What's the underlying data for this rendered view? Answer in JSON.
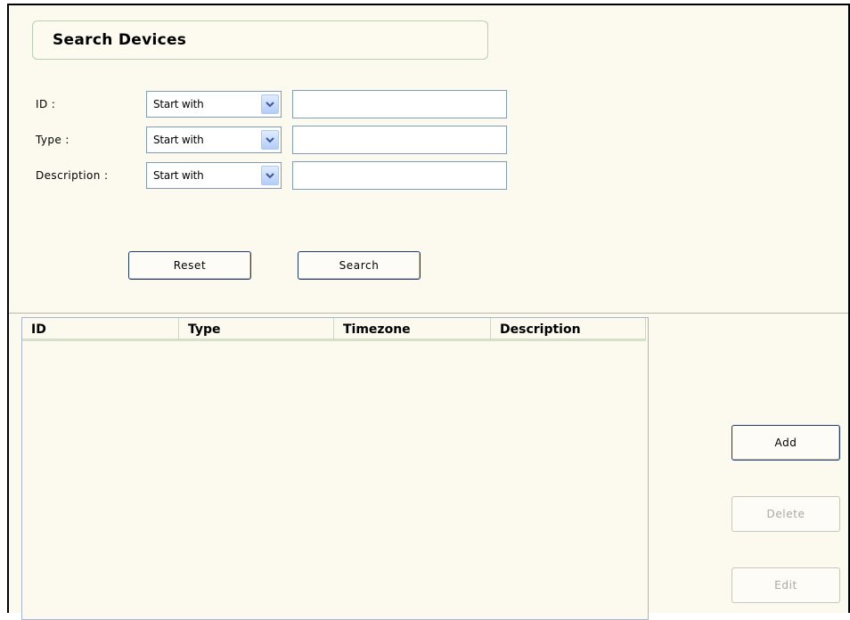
{
  "title": "Search Devices",
  "filters": [
    {
      "label": "ID :",
      "operator": "Start with",
      "value": ""
    },
    {
      "label": "Type :",
      "operator": "Start with",
      "value": ""
    },
    {
      "label": "Description :",
      "operator": "Start with",
      "value": ""
    }
  ],
  "buttons": {
    "reset": "Reset",
    "search": "Search",
    "add": "Add",
    "delete": "Delete",
    "edit": "Edit"
  },
  "table": {
    "columns": [
      "ID",
      "Type",
      "Timezone",
      "Description"
    ],
    "rows": []
  },
  "icons": {
    "dropdown": "chevron-down-icon"
  }
}
